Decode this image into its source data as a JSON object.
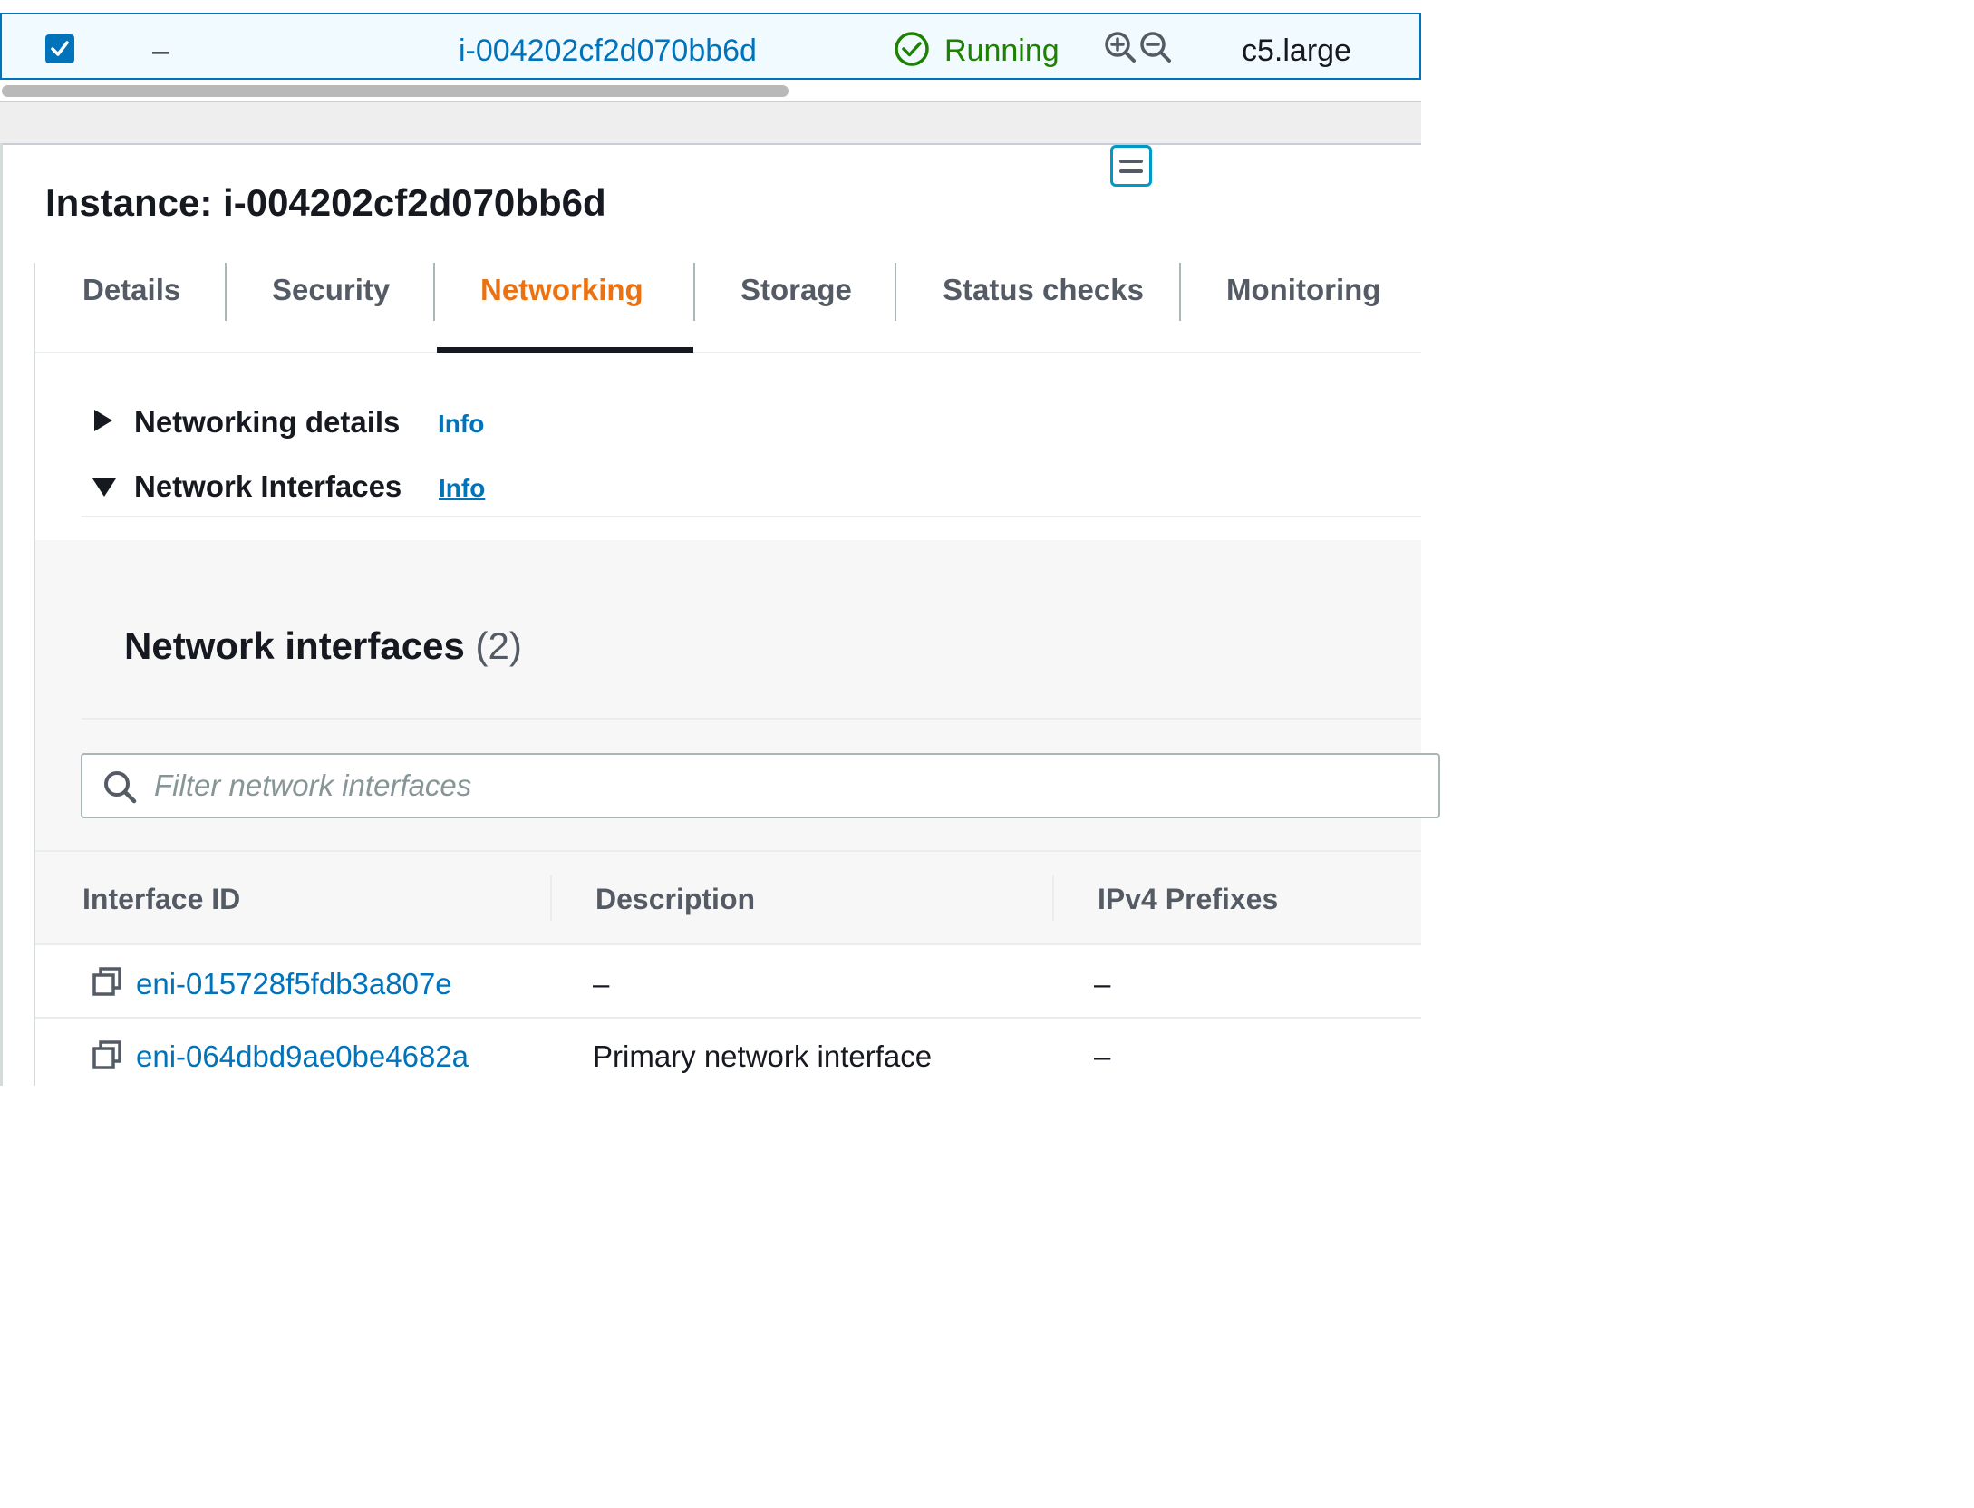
{
  "selected_row": {
    "name": "–",
    "instance_id": "i-004202cf2d070bb6d",
    "state": "Running",
    "instance_type": "c5.large",
    "icons": [
      "checkbox-checked-icon",
      "status-ok-icon",
      "zoom-in-icon",
      "zoom-out-icon"
    ]
  },
  "details": {
    "title": "Instance: i-004202cf2d070bb6d",
    "tabs": [
      {
        "label": "Details"
      },
      {
        "label": "Security"
      },
      {
        "label": "Networking"
      },
      {
        "label": "Storage"
      },
      {
        "label": "Status checks"
      },
      {
        "label": "Monitoring"
      }
    ],
    "active_tab": "Networking",
    "sections": [
      {
        "label": "Networking details",
        "info": "Info",
        "expanded": false
      },
      {
        "label": "Network Interfaces",
        "info": "Info",
        "expanded": true
      }
    ]
  },
  "network_interfaces": {
    "title": "Network interfaces",
    "count": "(2)",
    "filter_placeholder": "Filter network interfaces",
    "columns": [
      "Interface ID",
      "Description",
      "IPv4 Prefixes"
    ],
    "rows": [
      {
        "interface_id": "eni-015728f5fdb3a807e",
        "description": "–",
        "ipv4_prefixes": "–"
      },
      {
        "interface_id": "eni-064dbd9ae0be4682a",
        "description": "Primary network interface",
        "ipv4_prefixes": "–"
      }
    ]
  },
  "colors": {
    "link": "#0073bb",
    "active_tab": "#ec7211",
    "running": "#1d8102",
    "selection_border": "#0073bb"
  }
}
